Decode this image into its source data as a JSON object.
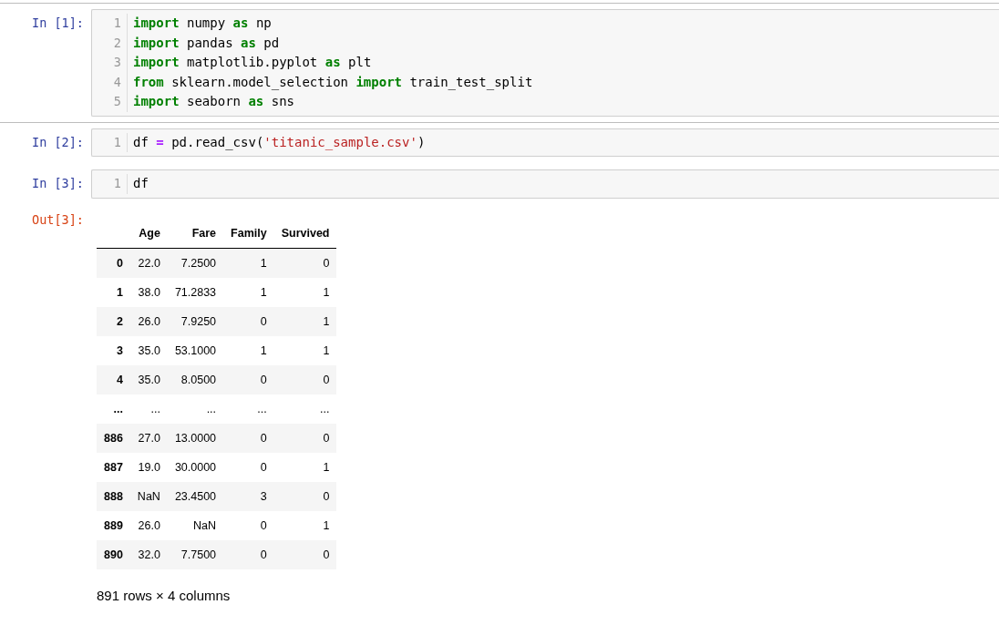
{
  "cells": [
    {
      "prompt": "In [1]:",
      "lines": [
        {
          "number": "1",
          "tokens": [
            {
              "kind": "keyword",
              "text": "import"
            },
            {
              "kind": "plain",
              "text": " numpy "
            },
            {
              "kind": "keyword",
              "text": "as"
            },
            {
              "kind": "plain",
              "text": " np"
            }
          ]
        },
        {
          "number": "2",
          "tokens": [
            {
              "kind": "keyword",
              "text": "import"
            },
            {
              "kind": "plain",
              "text": " pandas "
            },
            {
              "kind": "keyword",
              "text": "as"
            },
            {
              "kind": "plain",
              "text": " pd"
            }
          ]
        },
        {
          "number": "3",
          "tokens": [
            {
              "kind": "keyword",
              "text": "import"
            },
            {
              "kind": "plain",
              "text": " matplotlib.pyplot "
            },
            {
              "kind": "keyword",
              "text": "as"
            },
            {
              "kind": "plain",
              "text": " plt"
            }
          ]
        },
        {
          "number": "4",
          "tokens": [
            {
              "kind": "keyword",
              "text": "from"
            },
            {
              "kind": "plain",
              "text": " sklearn.model_selection "
            },
            {
              "kind": "keyword",
              "text": "import"
            },
            {
              "kind": "plain",
              "text": " train_test_split"
            }
          ]
        },
        {
          "number": "5",
          "tokens": [
            {
              "kind": "keyword",
              "text": "import"
            },
            {
              "kind": "plain",
              "text": " seaborn "
            },
            {
              "kind": "keyword",
              "text": "as"
            },
            {
              "kind": "plain",
              "text": " sns"
            }
          ]
        }
      ]
    },
    {
      "prompt": "In [2]:",
      "lines": [
        {
          "number": "1",
          "tokens": [
            {
              "kind": "plain",
              "text": "df "
            },
            {
              "kind": "operator",
              "text": "="
            },
            {
              "kind": "plain",
              "text": " pd.read_csv("
            },
            {
              "kind": "string",
              "text": "'titanic_sample.csv'"
            },
            {
              "kind": "plain",
              "text": ")"
            }
          ]
        }
      ]
    },
    {
      "prompt": "In [3]:",
      "lines": [
        {
          "number": "1",
          "tokens": [
            {
              "kind": "plain",
              "text": "df"
            }
          ]
        }
      ]
    }
  ],
  "output": {
    "prompt": "Out[3]:",
    "table": {
      "columns": [
        "Age",
        "Fare",
        "Family",
        "Survived"
      ],
      "rows": [
        {
          "index": "0",
          "cells": [
            "22.0",
            "7.2500",
            "1",
            "0"
          ]
        },
        {
          "index": "1",
          "cells": [
            "38.0",
            "71.2833",
            "1",
            "1"
          ]
        },
        {
          "index": "2",
          "cells": [
            "26.0",
            "7.9250",
            "0",
            "1"
          ]
        },
        {
          "index": "3",
          "cells": [
            "35.0",
            "53.1000",
            "1",
            "1"
          ]
        },
        {
          "index": "4",
          "cells": [
            "35.0",
            "8.0500",
            "0",
            "0"
          ]
        },
        {
          "index": "...",
          "cells": [
            "...",
            "...",
            "...",
            "..."
          ]
        },
        {
          "index": "886",
          "cells": [
            "27.0",
            "13.0000",
            "0",
            "0"
          ]
        },
        {
          "index": "887",
          "cells": [
            "19.0",
            "30.0000",
            "0",
            "1"
          ]
        },
        {
          "index": "888",
          "cells": [
            "NaN",
            "23.4500",
            "3",
            "0"
          ]
        },
        {
          "index": "889",
          "cells": [
            "26.0",
            "NaN",
            "0",
            "1"
          ]
        },
        {
          "index": "890",
          "cells": [
            "32.0",
            "7.7500",
            "0",
            "0"
          ]
        }
      ]
    },
    "footer": "891 rows × 4 columns"
  }
}
